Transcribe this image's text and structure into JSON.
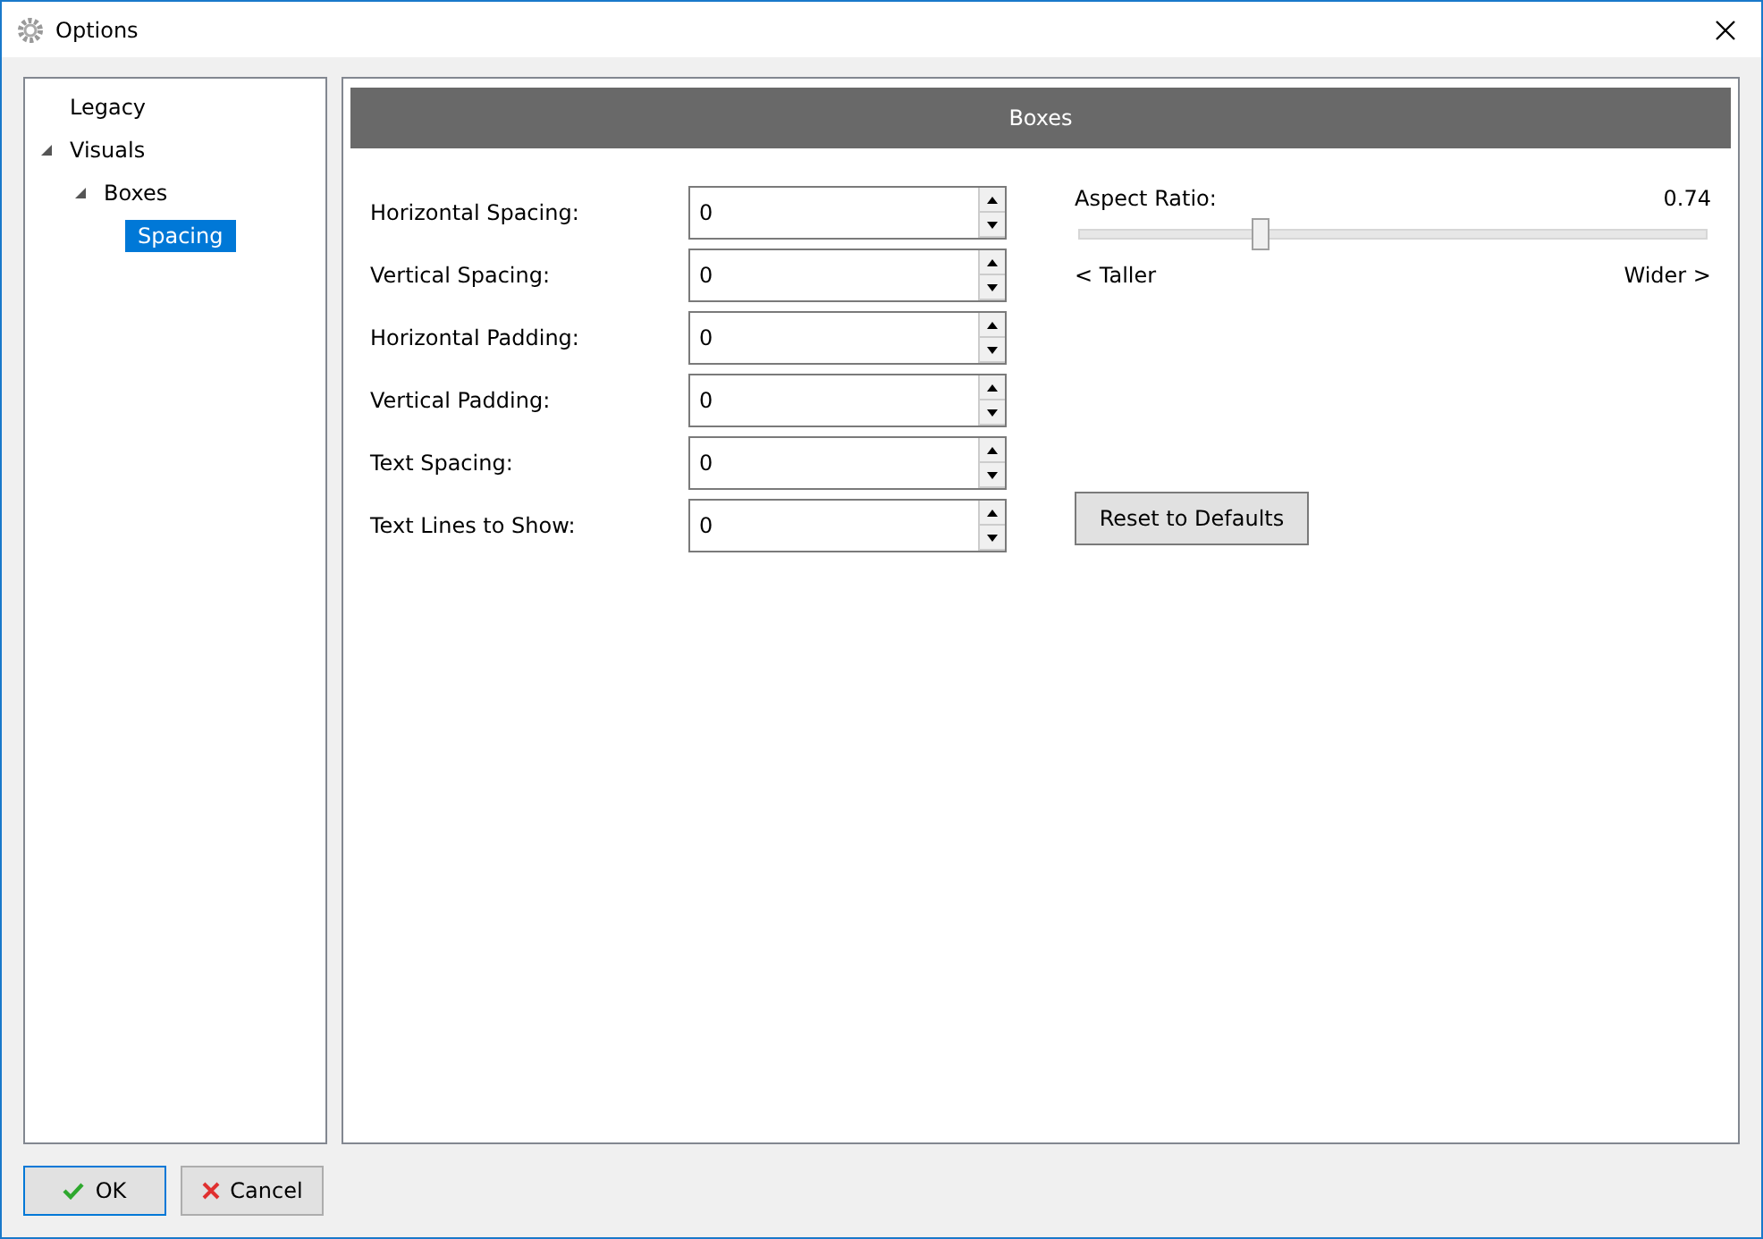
{
  "window": {
    "title": "Options"
  },
  "tree": [
    {
      "label": "Legacy",
      "selected": false
    },
    {
      "label": "Visuals",
      "selected": false,
      "expanded": true,
      "children": [
        {
          "label": "Boxes",
          "selected": false,
          "expanded": true,
          "children": [
            {
              "label": "Spacing",
              "selected": true
            }
          ]
        }
      ]
    }
  ],
  "panel": {
    "title": "Boxes",
    "fields": [
      {
        "label": "Horizontal Spacing:",
        "value": "0"
      },
      {
        "label": "Vertical Spacing:",
        "value": "0"
      },
      {
        "label": "Horizontal Padding:",
        "value": "0"
      },
      {
        "label": "Vertical Padding:",
        "value": "0"
      },
      {
        "label": "Text Spacing:",
        "value": "0"
      },
      {
        "label": "Text Lines to Show:",
        "value": "0"
      }
    ],
    "slider": {
      "label": "Aspect Ratio:",
      "reading": "0.74",
      "level": 0.29,
      "min_label": "< Taller",
      "max_label": "Wider >"
    },
    "reset_button": "Reset to Defaults"
  },
  "buttons": [
    {
      "kind": "ok",
      "label": "OK"
    },
    {
      "kind": "cancel",
      "label": "Cancel"
    }
  ]
}
